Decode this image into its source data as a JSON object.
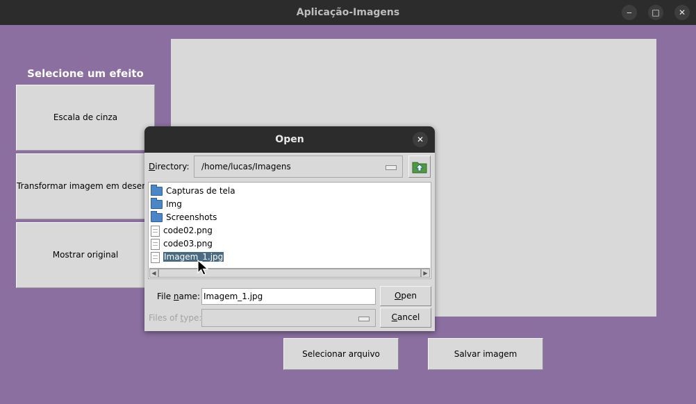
{
  "window": {
    "title": "Aplicação-Imagens",
    "minimize": "‒",
    "maximize": "□",
    "close": "✕"
  },
  "sidebar": {
    "title": "Selecione um efeito",
    "buttons": [
      {
        "label": "Escala de cinza"
      },
      {
        "label": "Transformar imagem em desenho"
      },
      {
        "label": "Mostrar original"
      }
    ]
  },
  "actions": {
    "select_file": "Selecionar arquivo",
    "save_image": "Salvar imagem"
  },
  "dialog": {
    "title": "Open",
    "close": "✕",
    "directory_label": {
      "pre": "",
      "u": "D",
      "post": "irectory:"
    },
    "directory_value": "/home/lucas/Imagens",
    "files": [
      {
        "name": "Capturas de tela",
        "type": "folder"
      },
      {
        "name": "Img",
        "type": "folder"
      },
      {
        "name": "Screenshots",
        "type": "folder"
      },
      {
        "name": "code02.png",
        "type": "file"
      },
      {
        "name": "code03.png",
        "type": "file"
      },
      {
        "name": "Imagem_1.jpg",
        "type": "file",
        "selected": true
      }
    ],
    "file_name_label": {
      "pre": "File ",
      "u": "n",
      "post": "ame:"
    },
    "file_name_value": "Imagem_1.jpg",
    "file_type_label": {
      "pre": "Files of ",
      "u": "t",
      "post": "ype:"
    },
    "open_button": {
      "pre": "",
      "u": "O",
      "post": "pen"
    },
    "cancel_button": {
      "pre": "",
      "u": "C",
      "post": "ancel"
    }
  },
  "colors": {
    "background": "#8b6fa1",
    "titlebar": "#2c2c2c",
    "selection": "#4a6984"
  }
}
